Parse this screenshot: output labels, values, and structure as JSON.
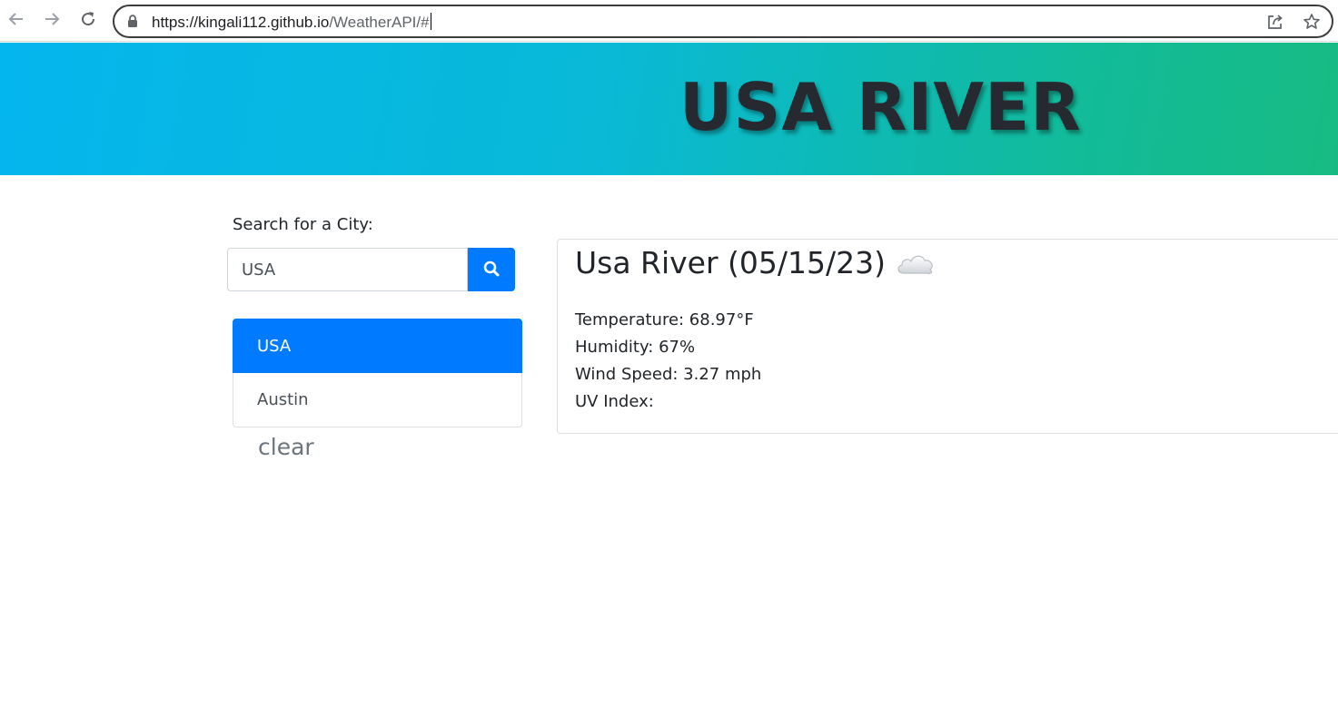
{
  "browser": {
    "url_host": "https://kingali112.github.io",
    "url_path": "/WeatherAPI/#",
    "icons": [
      "back-arrow-icon",
      "forward-arrow-icon",
      "reload-icon",
      "lock-icon",
      "share-icon",
      "star-icon"
    ]
  },
  "header": {
    "title": "USA RIVER"
  },
  "sidebar": {
    "search_label": "Search for a City:",
    "search_value": "USA",
    "search_icon": "search-icon",
    "history": [
      {
        "label": "USA",
        "active": true
      },
      {
        "label": "Austin",
        "active": false
      }
    ],
    "clear_label": "clear"
  },
  "weather": {
    "title": "Usa River (05/15/23)",
    "condition_icon": "cloud-icon",
    "temperature": "Temperature: 68.97°F",
    "humidity": "Humidity: 67%",
    "wind_speed": "Wind Speed: 3.27 mph",
    "uv_index": "UV Index:"
  },
  "colors": {
    "primary": "#007bff",
    "banner_start": "#04b6ee",
    "banner_end": "#17bb82",
    "title_text": "#262a30"
  }
}
